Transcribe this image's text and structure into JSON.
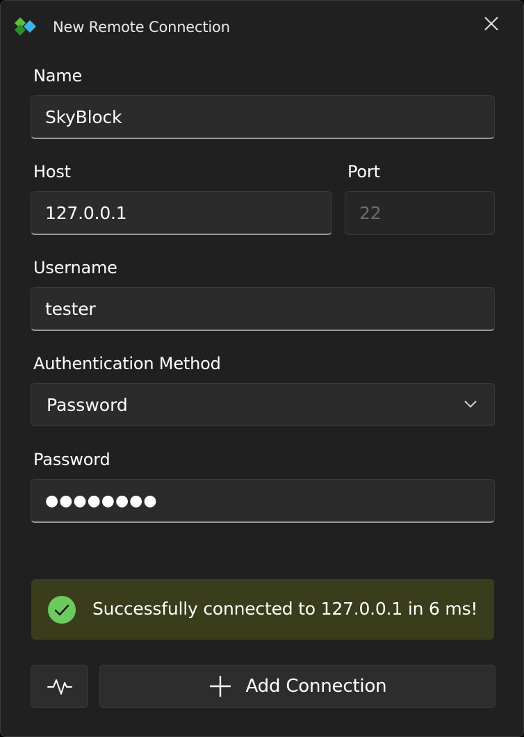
{
  "window": {
    "title": "New Remote Connection"
  },
  "form": {
    "name": {
      "label": "Name",
      "value": "SkyBlock"
    },
    "host": {
      "label": "Host",
      "value": "127.0.0.1"
    },
    "port": {
      "label": "Port",
      "placeholder": "22"
    },
    "username": {
      "label": "Username",
      "value": "tester"
    },
    "auth_method": {
      "label": "Authentication Method",
      "selected": "Password"
    },
    "password": {
      "label": "Password",
      "masked_value": "●●●●●●●●"
    }
  },
  "status": {
    "message": "Successfully connected to 127.0.0.1 in 6 ms!",
    "color": "#393d1b",
    "icon": "check-circle-icon",
    "icon_color": "#6ccb5f"
  },
  "actions": {
    "test_icon": "pulse-icon",
    "add_icon": "plus-icon",
    "add_label": "Add Connection"
  },
  "colors": {
    "window_bg": "#202020",
    "field_bg": "#2b2b2b",
    "accent_green": "#6ccb5f"
  }
}
